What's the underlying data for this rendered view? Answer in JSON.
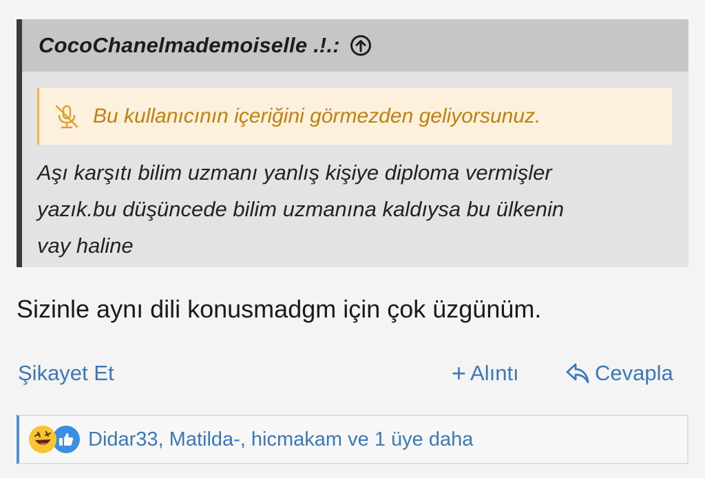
{
  "quote": {
    "author": "CocoChanelmademoiselle .!.:",
    "jump_icon": "arrow-up-circle-icon",
    "ignored_notice": "Bu kullanıcının içeriğini görmezden geliyorsunuz.",
    "ignored_icon": "muted-microphone-icon",
    "body_lines": [
      "Aşı karşıtı bilim uzmanı yanlış kişiye diploma vermişler",
      "yazık.bu düşüncede bilim uzmanına kaldıysa bu ülkenin",
      "vay haline"
    ]
  },
  "post": {
    "text": "Sizinle aynı dili konusmadgm için çok üzgünüm."
  },
  "actions": {
    "report_label": "Şikayet Et",
    "quote_plus": "+",
    "quote_label": "Alıntı",
    "reply_label": "Cevapla"
  },
  "reactions": {
    "icons": [
      "haha-reaction-icon",
      "like-reaction-icon"
    ],
    "users_text": "Didar33, Matilda-, hicmakam ve 1 üye daha"
  },
  "colors": {
    "link": "#3a78b6",
    "warning_text": "#c0810c",
    "warning_bg": "#fdf0dd",
    "quote_header_bg": "#c6c6c6",
    "quote_bg": "#e3e3e3"
  }
}
